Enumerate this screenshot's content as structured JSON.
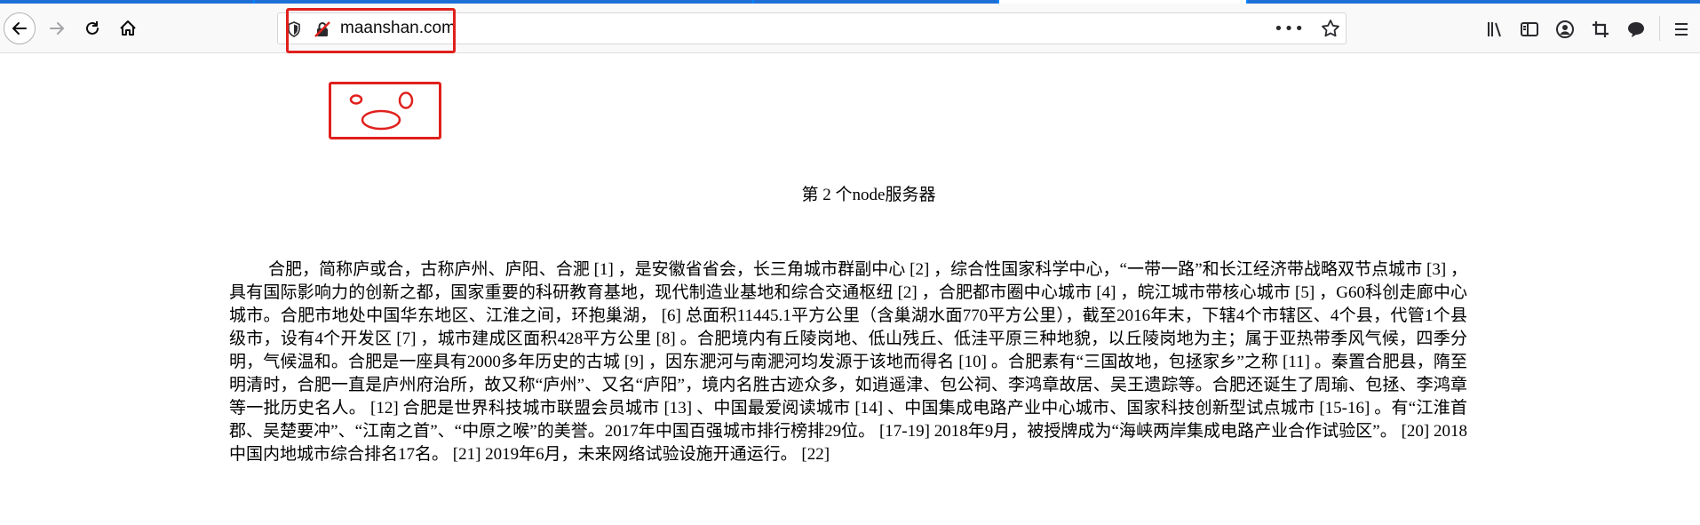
{
  "browser": {
    "url": "maanshan.com"
  },
  "page": {
    "heading": "第 2 个node服务器",
    "article": "合肥，简称庐或合，古称庐州、庐阳、合淝 [1] ，是安徽省省会，长三角城市群副中心 [2] ，综合性国家科学中心，“一带一路”和长江经济带战略双节点城市 [3] ，具有国际影响力的创新之都，国家重要的科研教育基地，现代制造业基地和综合交通枢纽 [2] ，合肥都市圈中心城市 [4] ，皖江城市带核心城市 [5] ，G60科创走廊中心城市。合肥市地处中国华东地区、江淮之间，环抱巢湖， [6] 总面积11445.1平方公里（含巢湖水面770平方公里），截至2016年末，下辖4个市辖区、4个县，代管1个县级市，设有4个开发区 [7] ，城市建成区面积428平方公里 [8] 。合肥境内有丘陵岗地、低山残丘、低洼平原三种地貌，以丘陵岗地为主；属于亚热带季风气候，四季分明，气候温和。合肥是一座具有2000多年历史的古城 [9] ，因东淝河与南淝河均发源于该地而得名 [10] 。合肥素有“三国故地，包拯家乡”之称 [11] 。秦置合肥县，隋至明清时，合肥一直是庐州府治所，故又称“庐州”、又名“庐阳”，境内名胜古迹众多，如逍遥津、包公祠、李鸿章故居、吴王遗踪等。合肥还诞生了周瑜、包拯、李鸿章等一批历史名人。 [12] 合肥是世界科技城市联盟会员城市 [13] 、中国最爱阅读城市 [14] 、中国集成电路产业中心城市、国家科技创新型试点城市 [15-16] 。有“江淮首郡、吴楚要冲”、“江南之首”、“中原之喉”的美誉。2017年中国百强城市排行榜排29位。 [17-19] 2018年9月，被授牌成为“海峡两岸集成电路产业合作试验区”。 [20] 2018中国内地城市综合排名17名。 [21] 2019年6月，未来网络试验设施开通运行。 [22]"
  },
  "colors": {
    "annotation": "#e0201c",
    "tab_accent": "#0a84ff"
  },
  "icons": [
    "back-arrow-icon",
    "forward-arrow-icon",
    "reload-icon",
    "home-icon",
    "tracking-shield-icon",
    "insecure-lock-icon",
    "page-actions-icon",
    "bookmark-star-icon",
    "library-icon",
    "sidebar-icon",
    "account-icon",
    "screenshot-icon",
    "chat-icon",
    "menu-icon"
  ]
}
